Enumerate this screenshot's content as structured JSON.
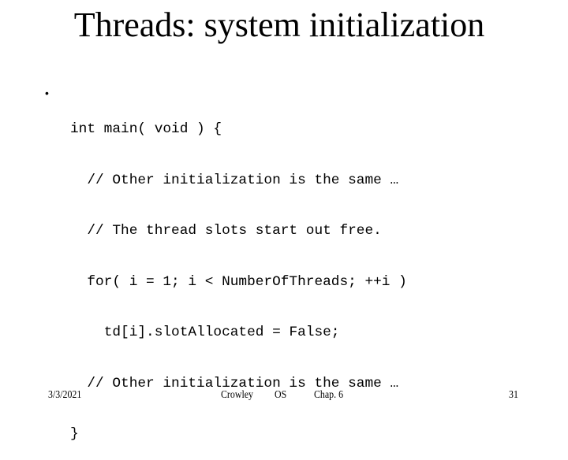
{
  "slide": {
    "title": "Threads: system initialization",
    "bullet_glyph": "•",
    "code_lines": [
      {
        "indent": 0,
        "text": "int main( void ) {"
      },
      {
        "indent": 2,
        "text": "// Other initialization is the same …"
      },
      {
        "indent": 2,
        "text": "// The thread slots start out free."
      },
      {
        "indent": 2,
        "text": "for( i = 1; i < NumberOfThreads; ++i )"
      },
      {
        "indent": 4,
        "text": "td[i].slotAllocated = False;"
      },
      {
        "indent": 2,
        "text": "// Other initialization is the same …"
      },
      {
        "indent": 0,
        "text": "}"
      }
    ]
  },
  "footer": {
    "date": "3/3/2021",
    "author": "Crowley",
    "course": "OS",
    "chapter": "Chap. 6",
    "page_number": "31"
  }
}
